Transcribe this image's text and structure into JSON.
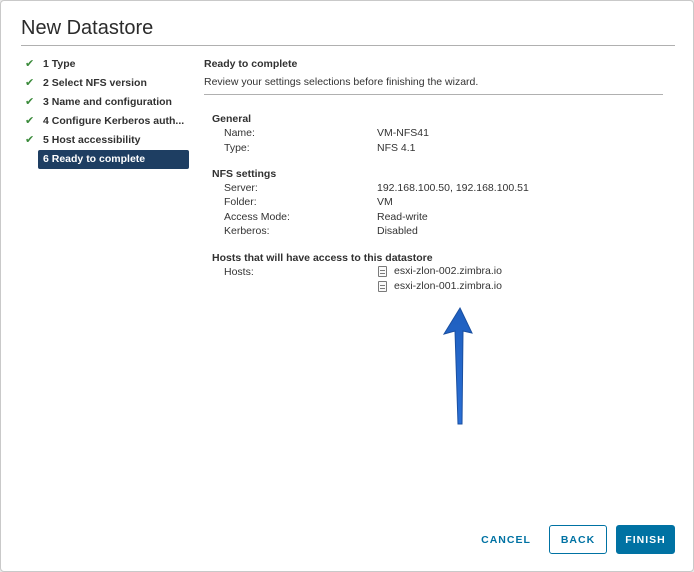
{
  "dialog": {
    "title": "New Datastore"
  },
  "steps": [
    {
      "label": "1 Type",
      "completed": true
    },
    {
      "label": "2 Select NFS version",
      "completed": true
    },
    {
      "label": "3 Name and configuration",
      "completed": true
    },
    {
      "label": "4 Configure Kerberos auth...",
      "completed": true
    },
    {
      "label": "5 Host accessibility",
      "completed": true
    },
    {
      "label": "6 Ready to complete",
      "completed": false,
      "active": true
    }
  ],
  "content": {
    "heading": "Ready to complete",
    "subtext": "Review your settings selections before finishing the wizard.",
    "general": {
      "title": "General",
      "name_label": "Name:",
      "name_value": "VM-NFS41",
      "type_label": "Type:",
      "type_value": "NFS 4.1"
    },
    "nfs": {
      "title": "NFS settings",
      "server_label": "Server:",
      "server_value": "192.168.100.50, 192.168.100.51",
      "folder_label": "Folder:",
      "folder_value": "VM",
      "access_label": "Access Mode:",
      "access_value": "Read-write",
      "kerberos_label": "Kerberos:",
      "kerberos_value": "Disabled"
    },
    "hosts": {
      "title": "Hosts that will have access to this datastore",
      "hosts_label": "Hosts:",
      "list": [
        "esxi-zlon-002.zimbra.io",
        "esxi-zlon-001.zimbra.io"
      ]
    }
  },
  "buttons": {
    "cancel": "CANCEL",
    "back": "BACK",
    "finish": "FINISH"
  },
  "colors": {
    "primary": "#0072a3",
    "active_step": "#1e3e62",
    "check": "#3a8a3a",
    "arrow": "#1f5fbf"
  }
}
